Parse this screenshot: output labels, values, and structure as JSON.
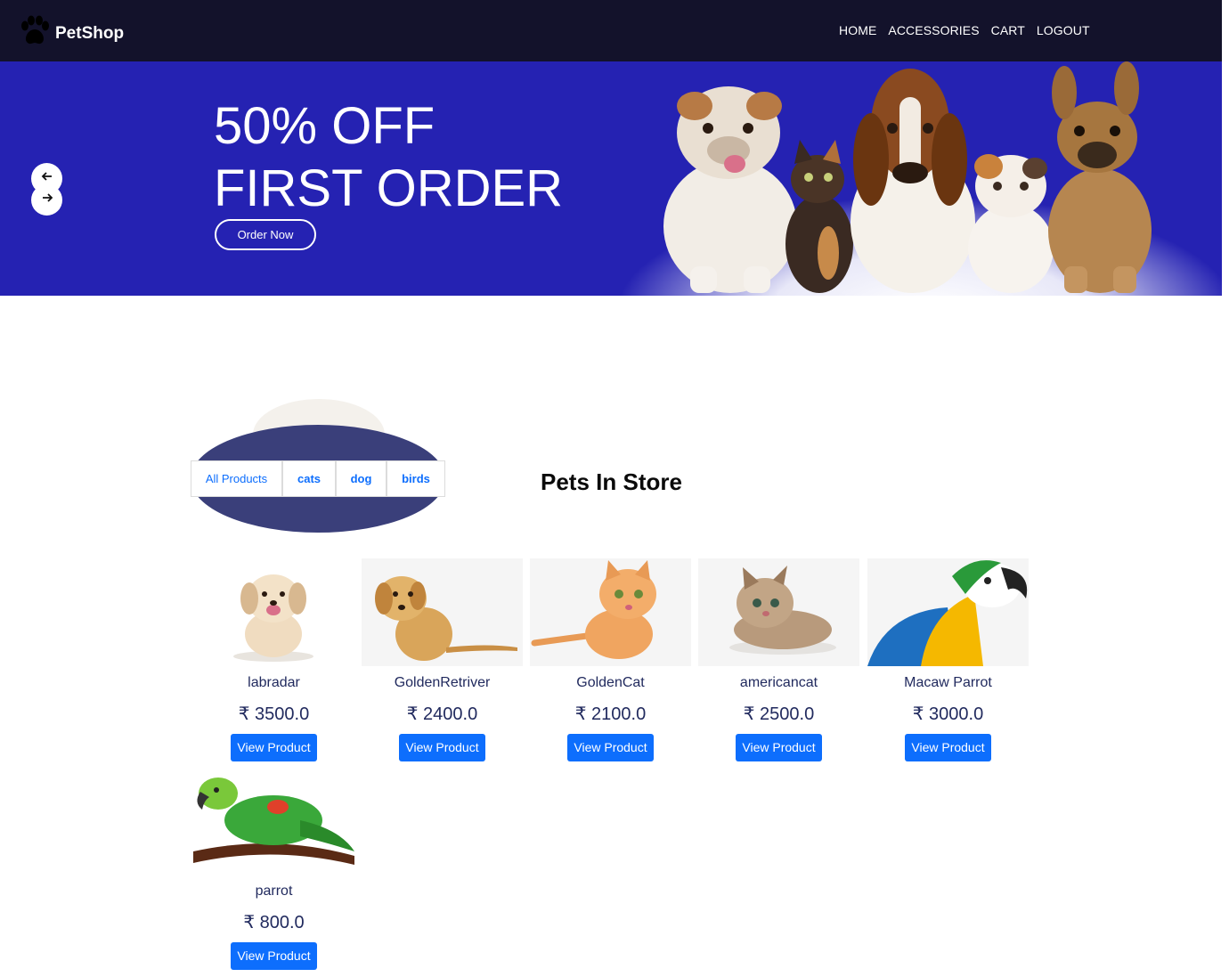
{
  "navbar": {
    "brand": "PetShop",
    "brand_icon": "paw-icon",
    "links": [
      "HOME",
      "ACCESSORIES",
      "CART",
      "LOGOUT"
    ]
  },
  "hero": {
    "title_line1": "50% OFF",
    "title_line2": "FIRST ORDER",
    "button_label": "Order Now",
    "prev_icon": "arrow-left-icon",
    "next_icon": "arrow-right-icon",
    "background_color": "#2522b2"
  },
  "filters": {
    "items": [
      "All Products",
      "cats",
      "dog",
      "birds"
    ]
  },
  "section": {
    "title": "Pets In Store"
  },
  "currency_symbol": "₹",
  "products": [
    {
      "name": "labradar",
      "price": "₹ 3500.0",
      "button": "View Product"
    },
    {
      "name": "GoldenRetriver",
      "price": "₹ 2400.0",
      "button": "View Product"
    },
    {
      "name": "GoldenCat",
      "price": "₹ 2100.0",
      "button": "View Product"
    },
    {
      "name": "americancat",
      "price": "₹ 2500.0",
      "button": "View Product"
    },
    {
      "name": "Macaw Parrot",
      "price": "₹ 3000.0",
      "button": "View Product"
    },
    {
      "name": "parrot",
      "price": "₹ 800.0",
      "button": "View Product"
    }
  ],
  "colors": {
    "navbar": "#13122b",
    "accent": "#0d6efd",
    "text_dark": "#212a5e"
  }
}
